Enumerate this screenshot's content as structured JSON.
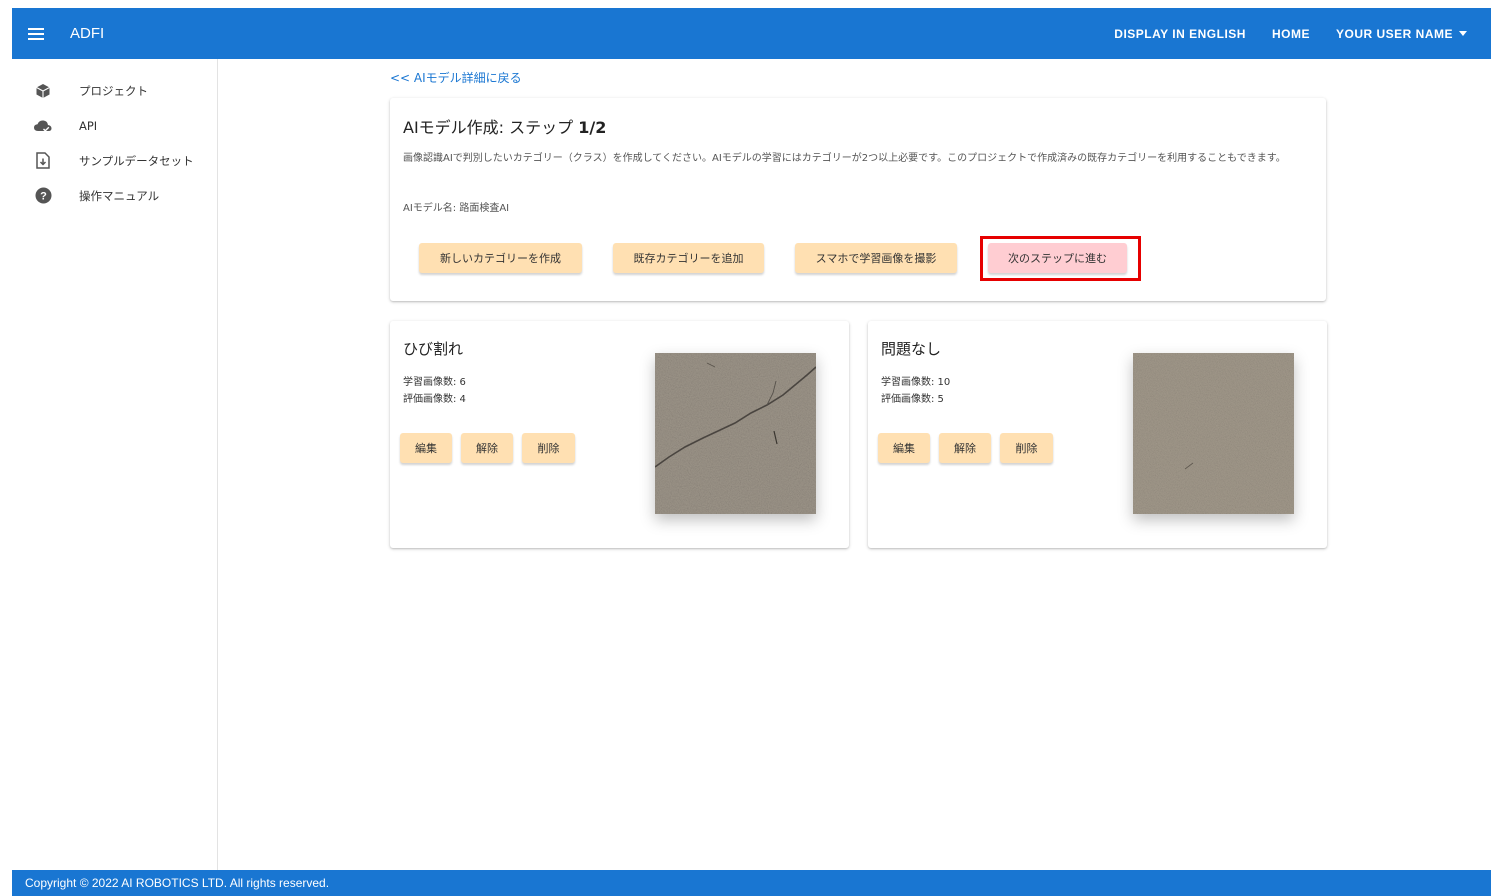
{
  "header": {
    "app_title": "ADFI",
    "menu_icon": "hamburger-menu-icon",
    "links": {
      "display_english": "DISPLAY IN ENGLISH",
      "home": "HOME",
      "user_name": "YOUR USER NAME"
    },
    "color": "#1976d2"
  },
  "sidebar": {
    "items": [
      {
        "label": "プロジェクト",
        "icon": "cube-icon"
      },
      {
        "label": "API",
        "icon": "cloud-check-icon"
      },
      {
        "label": "サンプルデータセット",
        "icon": "file-download-icon"
      },
      {
        "label": "操作マニュアル",
        "icon": "help-circle-icon"
      }
    ]
  },
  "main": {
    "back_link": "<< AIモデル詳細に戻る",
    "step": {
      "title_prefix": "AIモデル作成: ステップ ",
      "title_step": "1/2",
      "description": "画像認識AIで判別したいカテゴリー（クラス）を作成してください。AIモデルの学習にはカテゴリーが2つ以上必要です。このプロジェクトで作成済みの既存カテゴリーを利用することもできます。",
      "model_name": "AIモデル名: 路面検査AI",
      "buttons": {
        "new_category": "新しいカテゴリーを作成",
        "add_existing": "既存カテゴリーを追加",
        "phone_capture": "スマホで学習画像を撮影",
        "next_step": "次のステップに進む"
      }
    },
    "categories": [
      {
        "name": "ひび割れ",
        "train_count": "学習画像数: 6",
        "eval_count": "評価画像数: 4",
        "buttons": {
          "edit": "編集",
          "release": "解除",
          "delete": "削除"
        },
        "image": "cracked-asphalt-photo"
      },
      {
        "name": "問題なし",
        "train_count": "学習画像数: 10",
        "eval_count": "評価画像数: 5",
        "buttons": {
          "edit": "編集",
          "release": "解除",
          "delete": "削除"
        },
        "image": "smooth-asphalt-photo"
      }
    ]
  },
  "footer": {
    "copyright": "Copyright © 2022 AI ROBOTICS LTD. All rights reserved."
  },
  "colors": {
    "primary": "#1976d2",
    "button": "#ffe0b2",
    "next_button": "#ffcdd2",
    "highlight": "#e60000"
  }
}
